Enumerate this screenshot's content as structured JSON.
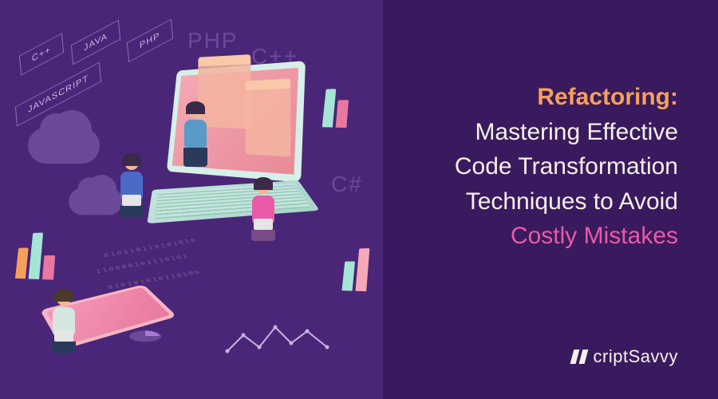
{
  "title": {
    "line1_accent": "Refactoring:",
    "line2": "Mastering Effective",
    "line3": "Code Transformation",
    "line4": "Techniques to Avoid",
    "line5_accent": "Costly Mistakes"
  },
  "brand": {
    "name": "criptSavvy"
  },
  "lang_tags": {
    "cpp": "C++",
    "java": "JAVA",
    "php": "PHP",
    "javascript": "JAVASCRIPT"
  },
  "ghost_langs": {
    "php": "PHP",
    "cpp": "C++",
    "csharp": "C#"
  },
  "binary_rows": [
    "010110110101010",
    "110000101110101",
    "010101010110100"
  ],
  "colors": {
    "bg_left": "#4a2678",
    "bg_right": "#3a1a5e",
    "accent_orange": "#f5a05a",
    "accent_pink": "#e85aa8",
    "text_light": "#f5f0e8"
  }
}
